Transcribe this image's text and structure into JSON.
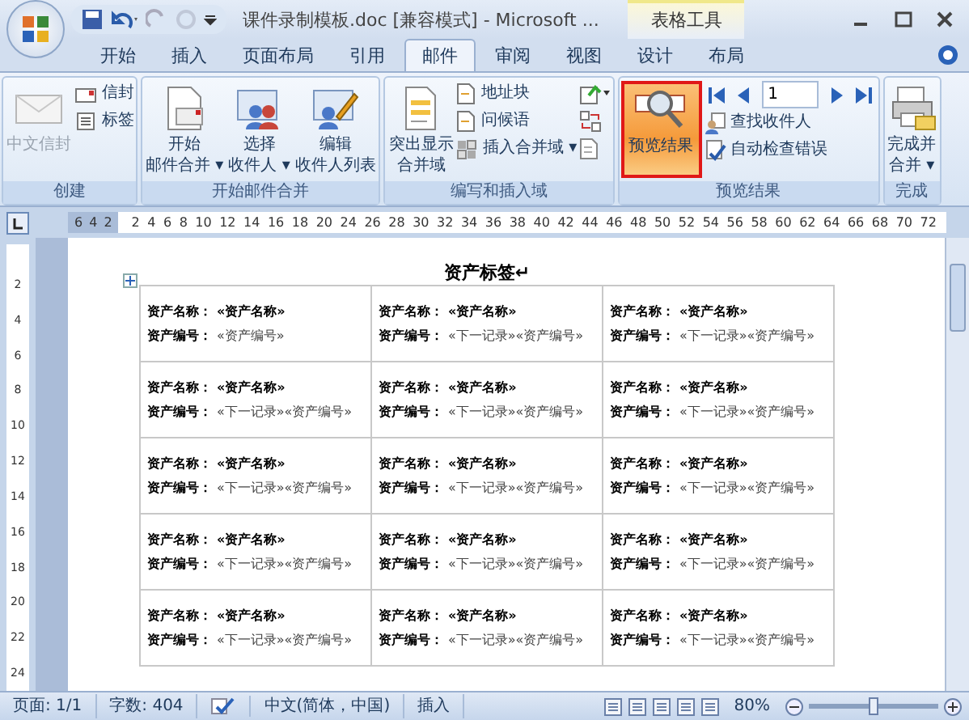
{
  "window": {
    "title": "课件录制模板.doc [兼容模式] - Microsoft ...",
    "context_tab": "表格工具"
  },
  "tabs": [
    {
      "label": "开始",
      "selected": false
    },
    {
      "label": "插入",
      "selected": false
    },
    {
      "label": "页面布局",
      "selected": false
    },
    {
      "label": "引用",
      "selected": false
    },
    {
      "label": "邮件",
      "selected": true
    },
    {
      "label": "审阅",
      "selected": false
    },
    {
      "label": "视图",
      "selected": false
    },
    {
      "label": "设计",
      "selected": false
    },
    {
      "label": "布局",
      "selected": false
    }
  ],
  "ribbon": {
    "groups": [
      {
        "label": "创建",
        "items": [
          {
            "kind": "large",
            "lines": [
              "中文信封"
            ],
            "disabled": true
          },
          {
            "kind": "stack",
            "entries": [
              "信封",
              "标签"
            ]
          }
        ]
      },
      {
        "label": "开始邮件合并",
        "items": [
          {
            "kind": "large",
            "lines": [
              "开始",
              "邮件合并 ▾"
            ]
          },
          {
            "kind": "large",
            "lines": [
              "选择",
              "收件人 ▾"
            ]
          },
          {
            "kind": "large",
            "lines": [
              "编辑",
              "收件人列表"
            ]
          }
        ]
      },
      {
        "label": "编写和插入域",
        "items": [
          {
            "kind": "large",
            "lines": [
              "突出显示",
              "合并域"
            ]
          },
          {
            "kind": "stack",
            "entries": [
              "地址块",
              "问候语",
              "插入合并域 ▾"
            ]
          },
          {
            "kind": "icons"
          }
        ]
      },
      {
        "label": "预览结果",
        "items": [
          {
            "kind": "large",
            "lines": [
              "预览结果"
            ],
            "selected": true
          },
          {
            "kind": "nav",
            "record": "1",
            "entries": [
              "查找收件人",
              "自动检查错误"
            ]
          }
        ]
      },
      {
        "label": "完成",
        "items": [
          {
            "kind": "large",
            "lines": [
              "完成并",
              "合并 ▾"
            ]
          }
        ]
      }
    ]
  },
  "ruler": {
    "left_ticks": [
      "6",
      "4",
      "2"
    ],
    "ticks": [
      "2",
      "4",
      "6",
      "8",
      "10",
      "12",
      "14",
      "16",
      "18",
      "20",
      "24",
      "26",
      "28",
      "30",
      "32",
      "34",
      "36",
      "38",
      "40",
      "42",
      "44",
      "46",
      "48",
      "50",
      "52",
      "54",
      "56",
      "58",
      "60",
      "62",
      "64",
      "66",
      "68",
      "70",
      "72"
    ],
    "vertical_ticks": [
      "2",
      "4",
      "6",
      "8",
      "10",
      "12",
      "14",
      "16",
      "18",
      "20",
      "22",
      "24"
    ]
  },
  "document": {
    "heading": "资产标签↵",
    "table": {
      "rows": [
        [
          {
            "name_label": "资产名称：",
            "name_value": "«资产名称»",
            "code_label": "资产编号：",
            "code_value": "«资产编号»"
          },
          {
            "name_label": "资产名称：",
            "name_value": "«资产名称»",
            "code_label": "资产编号：",
            "code_value": "«下一记录»«资产编号»"
          },
          {
            "name_label": "资产名称：",
            "name_value": "«资产名称»",
            "code_label": "资产编号：",
            "code_value": "«下一记录»«资产编号»"
          }
        ],
        [
          {
            "name_label": "资产名称：",
            "name_value": "«资产名称»",
            "code_label": "资产编号：",
            "code_value": "«下一记录»«资产编号»"
          },
          {
            "name_label": "资产名称：",
            "name_value": "«资产名称»",
            "code_label": "资产编号：",
            "code_value": "«下一记录»«资产编号»"
          },
          {
            "name_label": "资产名称：",
            "name_value": "«资产名称»",
            "code_label": "资产编号：",
            "code_value": "«下一记录»«资产编号»"
          }
        ],
        [
          {
            "name_label": "资产名称：",
            "name_value": "«资产名称»",
            "code_label": "资产编号：",
            "code_value": "«下一记录»«资产编号»"
          },
          {
            "name_label": "资产名称：",
            "name_value": "«资产名称»",
            "code_label": "资产编号：",
            "code_value": "«下一记录»«资产编号»"
          },
          {
            "name_label": "资产名称：",
            "name_value": "«资产名称»",
            "code_label": "资产编号：",
            "code_value": "«下一记录»«资产编号»"
          }
        ],
        [
          {
            "name_label": "资产名称：",
            "name_value": "«资产名称»",
            "code_label": "资产编号：",
            "code_value": "«下一记录»«资产编号»"
          },
          {
            "name_label": "资产名称：",
            "name_value": "«资产名称»",
            "code_label": "资产编号：",
            "code_value": "«下一记录»«资产编号»"
          },
          {
            "name_label": "资产名称：",
            "name_value": "«资产名称»",
            "code_label": "资产编号：",
            "code_value": "«下一记录»«资产编号»"
          }
        ],
        [
          {
            "name_label": "资产名称：",
            "name_value": "«资产名称»",
            "code_label": "资产编号：",
            "code_value": "«下一记录»«资产编号»"
          },
          {
            "name_label": "资产名称：",
            "name_value": "«资产名称»",
            "code_label": "资产编号：",
            "code_value": "«下一记录»«资产编号»"
          },
          {
            "name_label": "资产名称：",
            "name_value": "«资产名称»",
            "code_label": "资产编号：",
            "code_value": "«下一记录»«资产编号»"
          }
        ]
      ]
    }
  },
  "status_bar": {
    "items": [
      "页面: 1/1",
      "字数: 404",
      "中文(简体，中国)",
      "插入"
    ],
    "zoom": "80%",
    "zoom_slider": {
      "level": 0.5
    }
  }
}
